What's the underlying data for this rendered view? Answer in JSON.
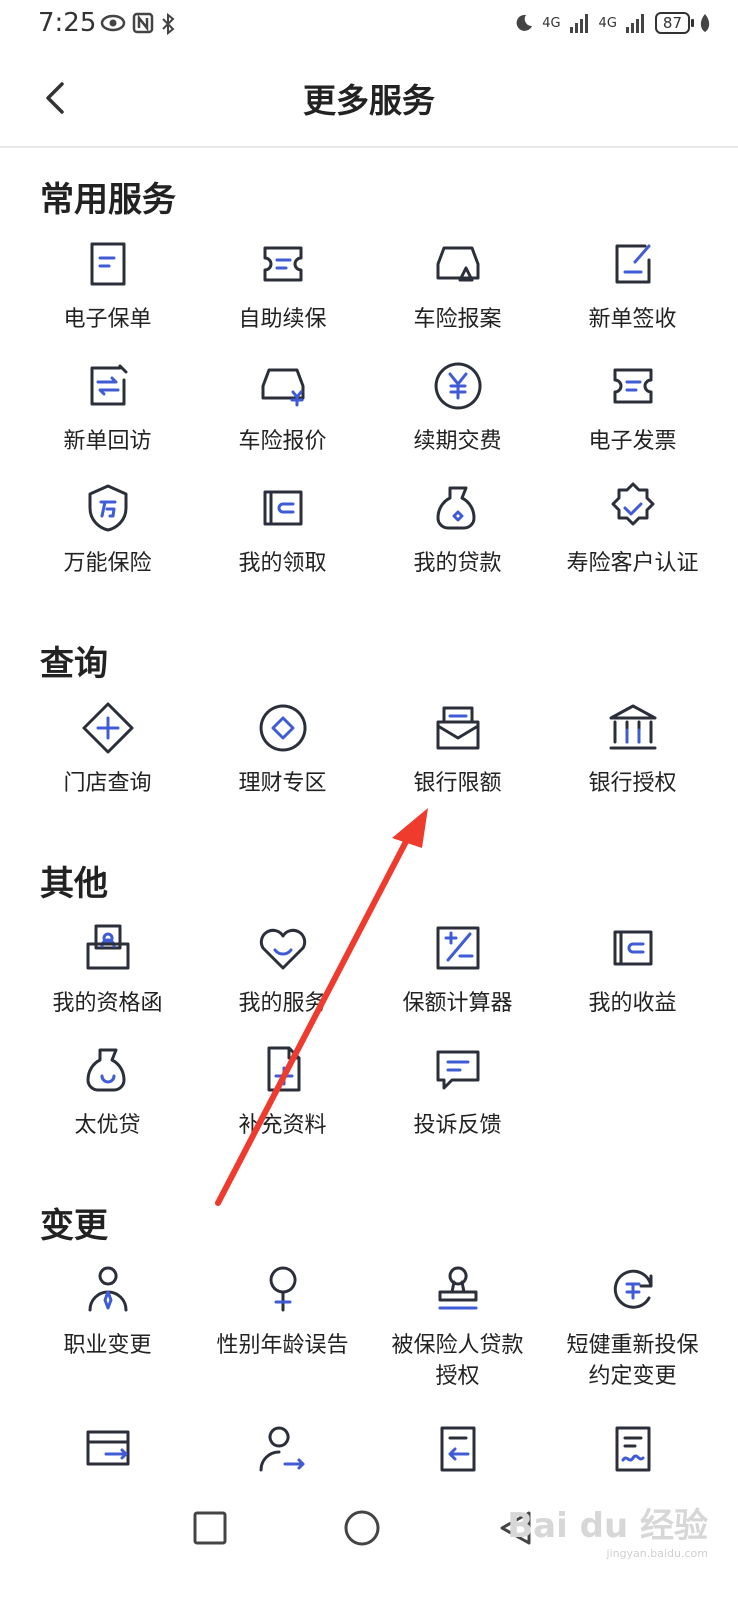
{
  "status_bar": {
    "time": "7:25",
    "left_icons": [
      "eye-icon",
      "nfc-icon",
      "bluetooth-icon"
    ],
    "network_1": "4G",
    "network_2": "4G",
    "battery": "87"
  },
  "header": {
    "title": "更多服务"
  },
  "sections": [
    {
      "title": "常用服务",
      "items": [
        {
          "label": "电子保单",
          "icon": "policy-icon"
        },
        {
          "label": "自助续保",
          "icon": "renewal-icon"
        },
        {
          "label": "车险报案",
          "icon": "car-claim-icon"
        },
        {
          "label": "新单签收",
          "icon": "sign-icon"
        },
        {
          "label": "新单回访",
          "icon": "revisit-icon"
        },
        {
          "label": "车险报价",
          "icon": "car-quote-icon"
        },
        {
          "label": "续期交费",
          "icon": "yen-payment-icon"
        },
        {
          "label": "电子发票",
          "icon": "invoice-icon"
        },
        {
          "label": "万能保险",
          "icon": "universal-insurance-icon"
        },
        {
          "label": "我的领取",
          "icon": "wallet-icon"
        },
        {
          "label": "我的贷款",
          "icon": "money-bag-icon"
        },
        {
          "label": "寿险客户认证",
          "icon": "verified-badge-icon"
        }
      ]
    },
    {
      "title": "查询",
      "items": [
        {
          "label": "门店查询",
          "icon": "store-search-icon"
        },
        {
          "label": "理财专区",
          "icon": "finance-icon"
        },
        {
          "label": "银行限额",
          "icon": "bank-limit-icon"
        },
        {
          "label": "银行授权",
          "icon": "bank-icon"
        }
      ]
    },
    {
      "title": "其他",
      "items": [
        {
          "label": "我的资格函",
          "icon": "qualification-icon"
        },
        {
          "label": "我的服务",
          "icon": "heart-service-icon"
        },
        {
          "label": "保额计算器",
          "icon": "calculator-icon"
        },
        {
          "label": "我的收益",
          "icon": "earnings-icon"
        },
        {
          "label": "太优贷",
          "icon": "loan-bag-icon"
        },
        {
          "label": "补充资料",
          "icon": "add-document-icon"
        },
        {
          "label": "投诉反馈",
          "icon": "feedback-icon"
        }
      ]
    },
    {
      "title": "变更",
      "items": [
        {
          "label": "职业变更",
          "icon": "occupation-icon"
        },
        {
          "label": "性别年龄误告",
          "icon": "gender-icon"
        },
        {
          "label": "被保险人贷款\n授权",
          "icon": "stamp-icon"
        },
        {
          "label": "短健重新投保\n约定变更",
          "icon": "reinsure-icon"
        },
        {
          "label": "",
          "icon": "card-transfer-icon"
        },
        {
          "label": "",
          "icon": "person-transfer-icon"
        },
        {
          "label": "",
          "icon": "document-return-icon"
        },
        {
          "label": "",
          "icon": "document-sign-icon"
        }
      ]
    }
  ],
  "watermark": {
    "brand": "Bai du 经验",
    "url": "jingyan.baidu.com"
  },
  "colors": {
    "accent": "#3f5bd6",
    "line": "#2b2f3a"
  }
}
